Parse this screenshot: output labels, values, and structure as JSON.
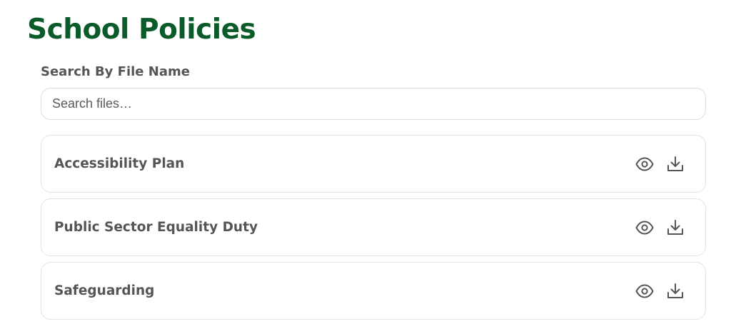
{
  "page": {
    "title": "School Policies"
  },
  "search": {
    "label": "Search By File Name",
    "placeholder": "Search files…",
    "value": ""
  },
  "files": [
    {
      "name": "Accessibility Plan",
      "actions": [
        "eye-icon",
        "download-icon"
      ]
    },
    {
      "name": "Public Sector Equality Duty",
      "actions": [
        "eye-icon",
        "download-icon"
      ]
    },
    {
      "name": "Safeguarding",
      "actions": [
        "eye-icon",
        "download-icon"
      ]
    }
  ],
  "colors": {
    "title": "#0b5a2a",
    "text": "#555555",
    "border": "#e3e3e3"
  }
}
